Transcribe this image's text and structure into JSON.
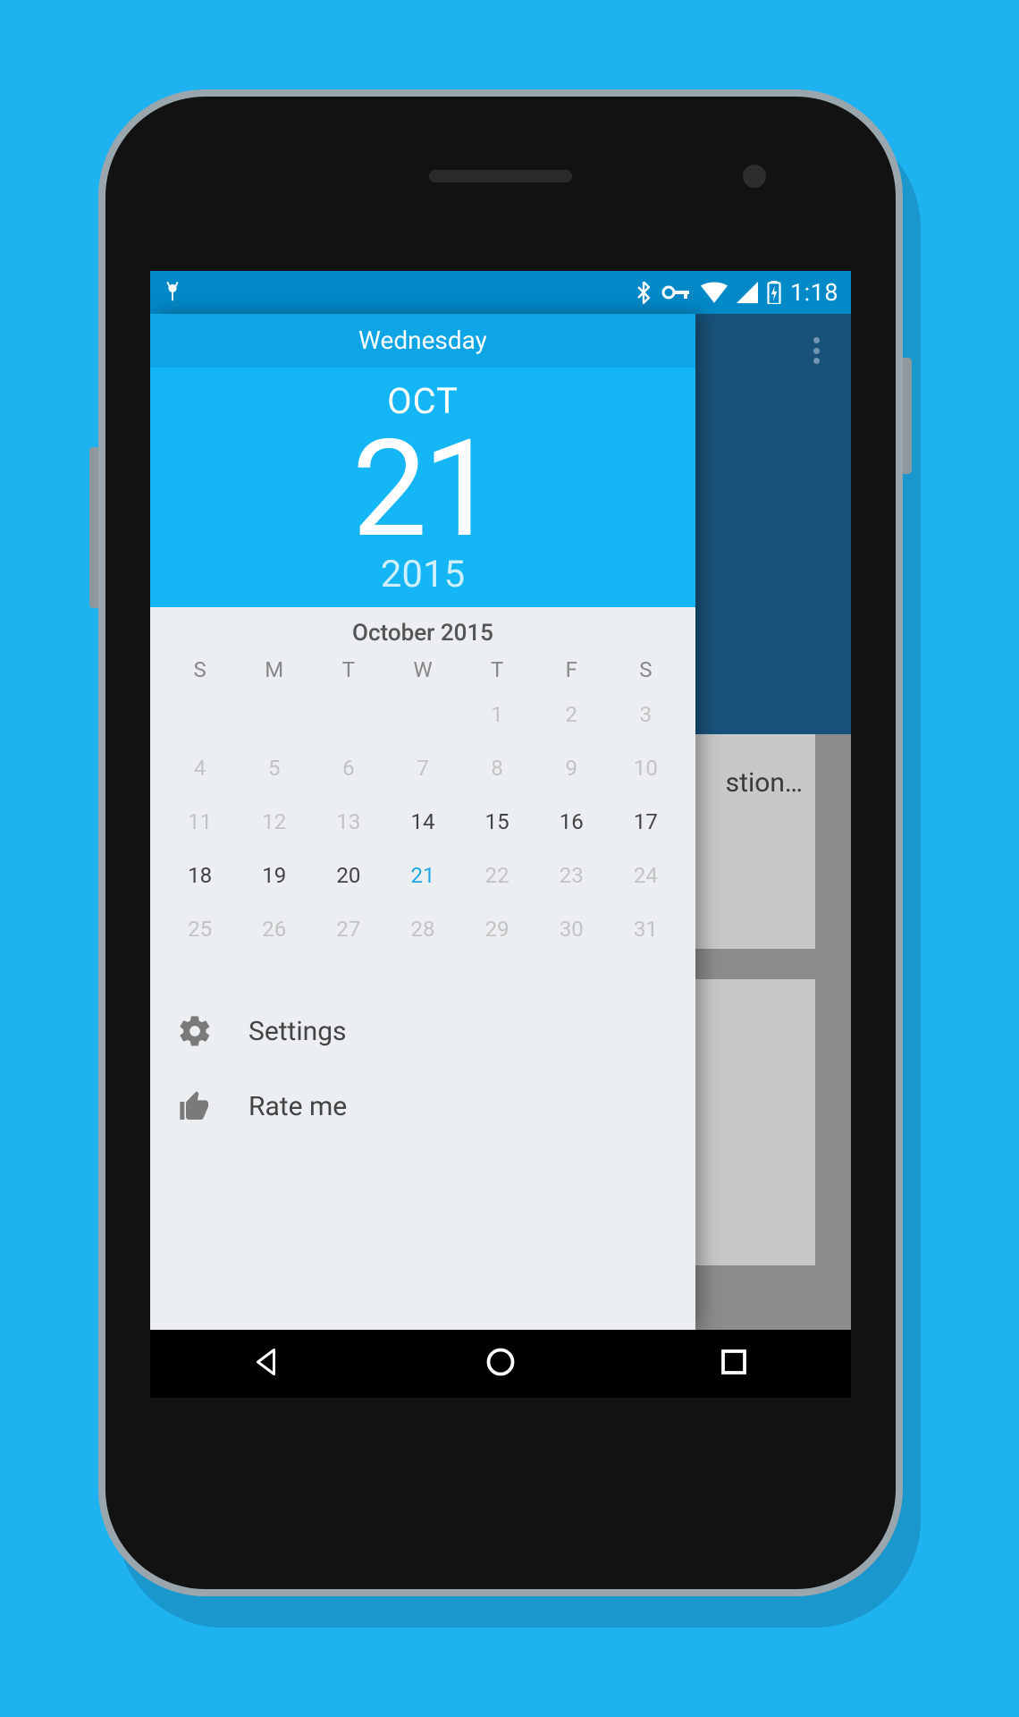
{
  "statusbar": {
    "time": "1:18"
  },
  "background": {
    "card_text": "stion…"
  },
  "drawer": {
    "weekday": "Wednesday",
    "month_abbr": "OCT",
    "day": "21",
    "year": "2015",
    "calendar": {
      "title": "October 2015",
      "dow": [
        "S",
        "M",
        "T",
        "W",
        "T",
        "F",
        "S"
      ],
      "cells": [
        {
          "t": ""
        },
        {
          "t": ""
        },
        {
          "t": ""
        },
        {
          "t": ""
        },
        {
          "t": "1"
        },
        {
          "t": "2"
        },
        {
          "t": "3"
        },
        {
          "t": "4"
        },
        {
          "t": "5"
        },
        {
          "t": "6"
        },
        {
          "t": "7"
        },
        {
          "t": "8"
        },
        {
          "t": "9"
        },
        {
          "t": "10"
        },
        {
          "t": "11"
        },
        {
          "t": "12"
        },
        {
          "t": "13"
        },
        {
          "t": "14",
          "b": true
        },
        {
          "t": "15",
          "b": true
        },
        {
          "t": "16",
          "b": true
        },
        {
          "t": "17",
          "b": true
        },
        {
          "t": "18",
          "b": true
        },
        {
          "t": "19",
          "b": true
        },
        {
          "t": "20",
          "b": true
        },
        {
          "t": "21",
          "b": true,
          "sel": true
        },
        {
          "t": "22"
        },
        {
          "t": "23"
        },
        {
          "t": "24"
        },
        {
          "t": "25"
        },
        {
          "t": "26"
        },
        {
          "t": "27"
        },
        {
          "t": "28"
        },
        {
          "t": "29"
        },
        {
          "t": "30"
        },
        {
          "t": "31"
        }
      ]
    },
    "menu": {
      "settings": "Settings",
      "rate_me": "Rate me"
    }
  }
}
